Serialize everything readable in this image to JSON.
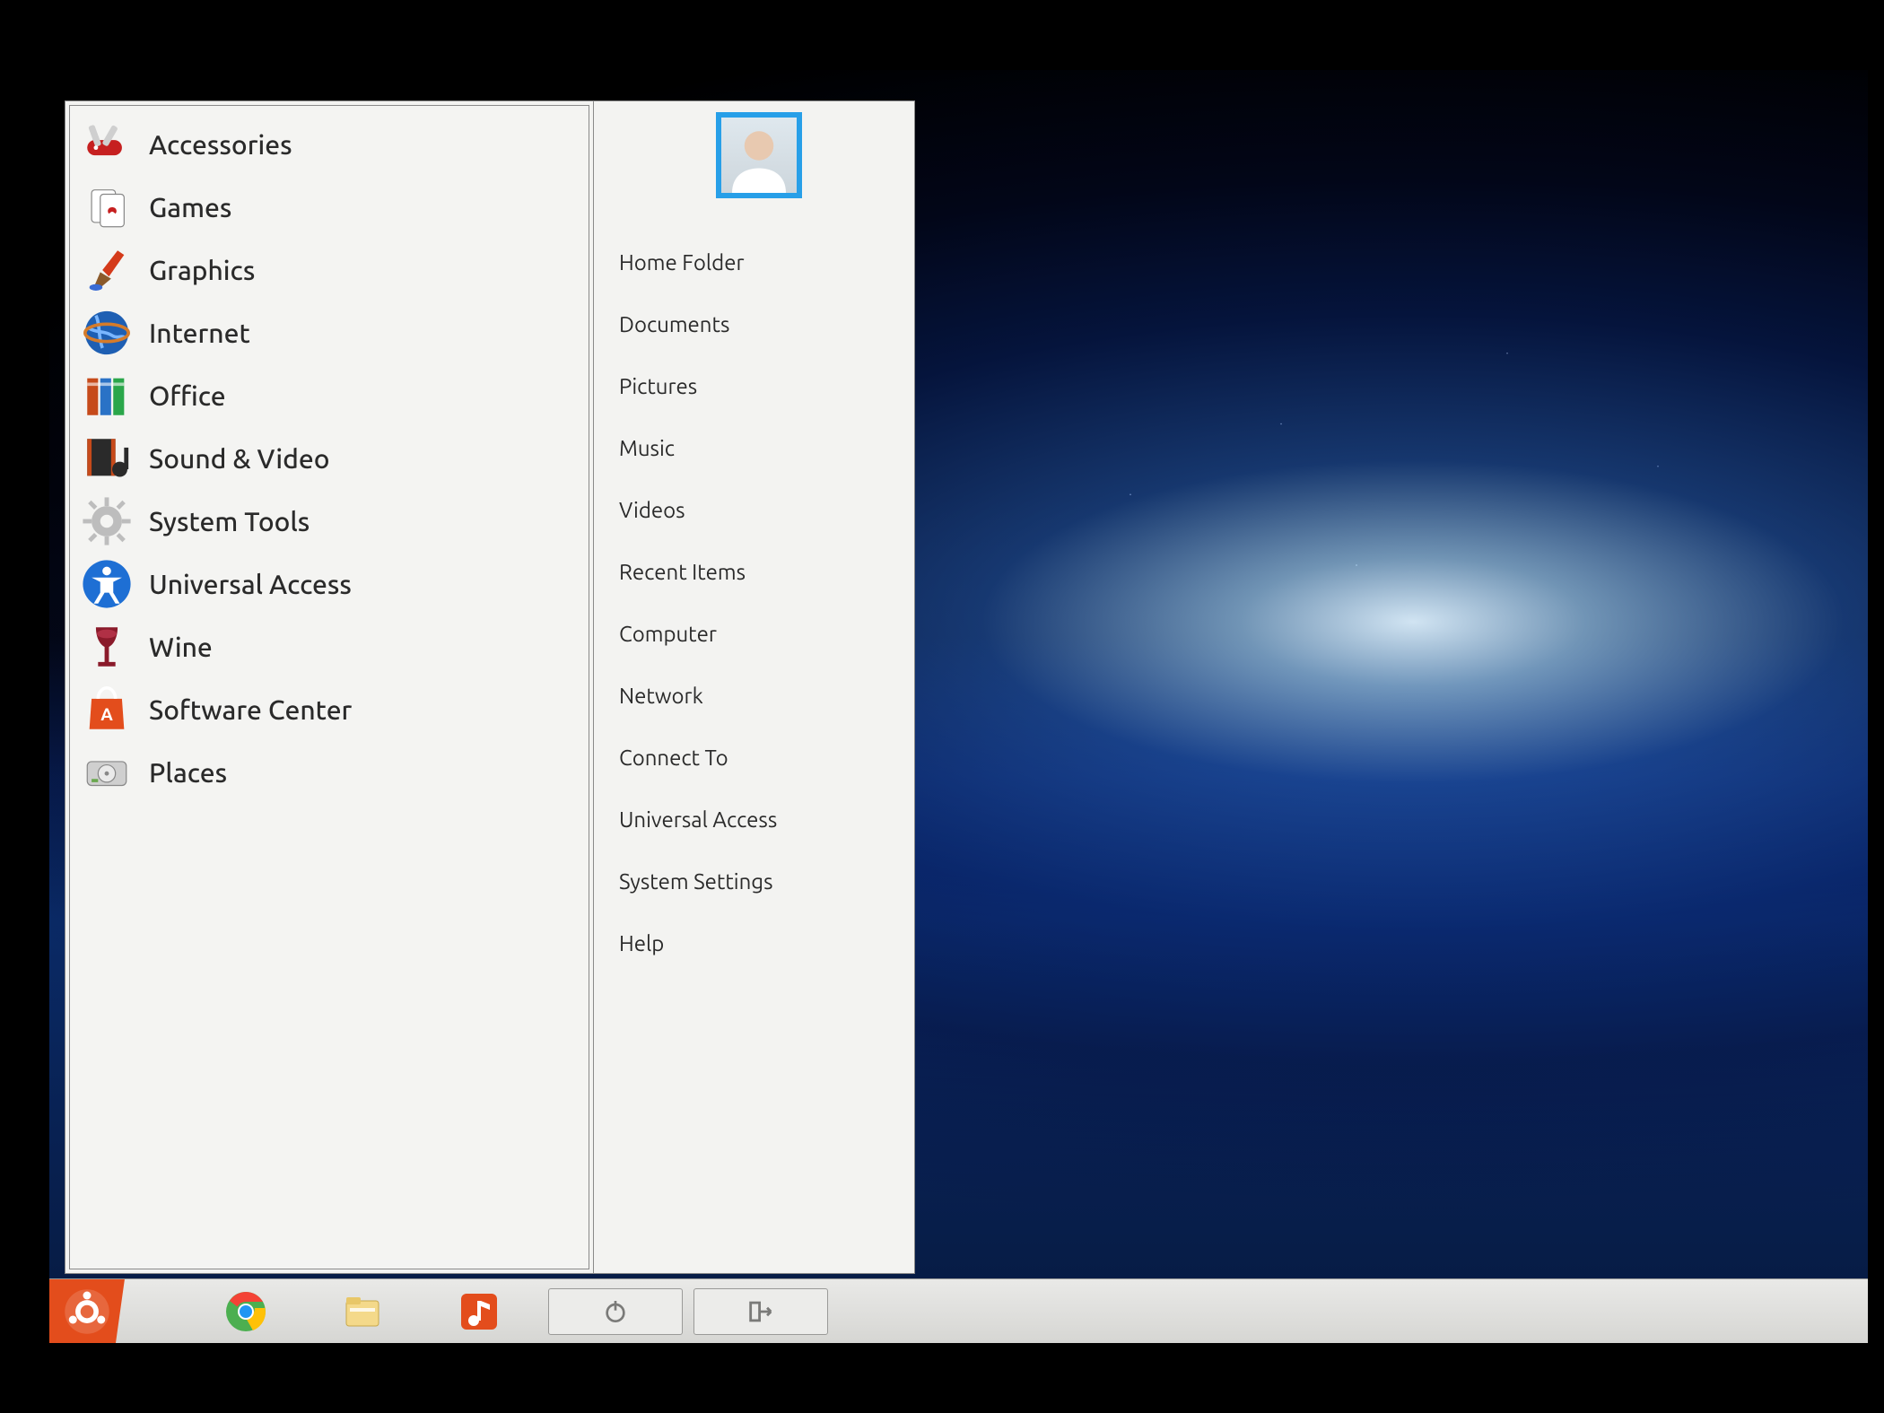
{
  "menu": {
    "categories": [
      {
        "id": "accessories",
        "label": "Accessories",
        "icon": "swiss-knife-icon"
      },
      {
        "id": "games",
        "label": "Games",
        "icon": "cards-icon"
      },
      {
        "id": "graphics",
        "label": "Graphics",
        "icon": "paintbrush-icon"
      },
      {
        "id": "internet",
        "label": "Internet",
        "icon": "globe-icon"
      },
      {
        "id": "office",
        "label": "Office",
        "icon": "books-icon"
      },
      {
        "id": "sound-video",
        "label": "Sound & Video",
        "icon": "film-music-icon"
      },
      {
        "id": "system-tools",
        "label": "System Tools",
        "icon": "gear-icon"
      },
      {
        "id": "universal-access",
        "label": "Universal Access",
        "icon": "accessibility-icon"
      },
      {
        "id": "wine",
        "label": "Wine",
        "icon": "wine-glass-icon"
      },
      {
        "id": "software-center",
        "label": "Software Center",
        "icon": "shopping-bag-icon"
      },
      {
        "id": "places",
        "label": "Places",
        "icon": "disk-drive-icon"
      }
    ],
    "places": [
      {
        "id": "home",
        "label": "Home Folder"
      },
      {
        "id": "documents",
        "label": "Documents"
      },
      {
        "id": "pictures",
        "label": "Pictures"
      },
      {
        "id": "music",
        "label": "Music"
      },
      {
        "id": "videos",
        "label": "Videos"
      },
      {
        "id": "recent",
        "label": "Recent Items"
      },
      {
        "id": "computer",
        "label": "Computer"
      },
      {
        "id": "network",
        "label": "Network"
      },
      {
        "id": "connect-to",
        "label": "Connect To"
      },
      {
        "id": "ua",
        "label": "Universal Access"
      },
      {
        "id": "system-settings",
        "label": "System Settings"
      },
      {
        "id": "help",
        "label": "Help"
      }
    ]
  },
  "taskbar": {
    "start": {
      "icon": "ubuntu-logo-icon"
    },
    "pinned": [
      {
        "id": "chrome",
        "icon": "chrome-icon"
      },
      {
        "id": "files",
        "icon": "file-manager-icon"
      },
      {
        "id": "music",
        "icon": "music-player-icon"
      }
    ],
    "controls": [
      {
        "id": "power",
        "icon": "power-icon"
      },
      {
        "id": "logout",
        "icon": "logout-icon"
      }
    ]
  },
  "colors": {
    "accent": "#279fe8",
    "ubuntu": "#e34d1c",
    "panelBg": "#f3f3f1",
    "text": "#2a2a2a"
  }
}
